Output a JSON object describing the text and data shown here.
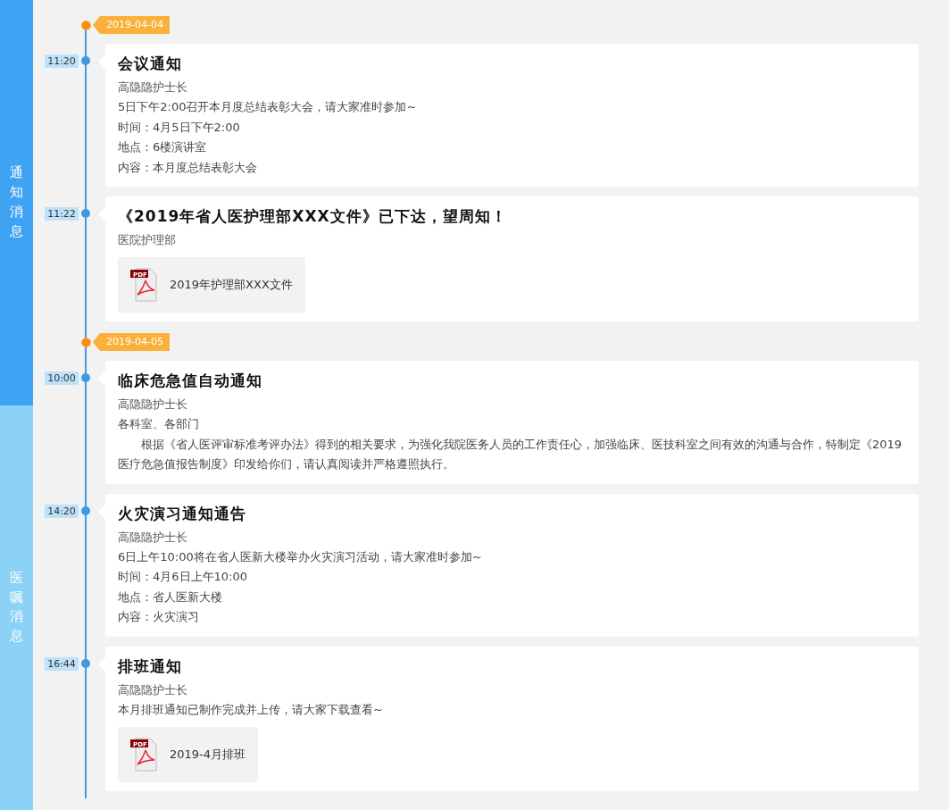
{
  "sidebar": {
    "tabs": [
      {
        "label": "通知消息",
        "selected": true
      },
      {
        "label": "医嘱消息",
        "selected": false
      }
    ]
  },
  "timeline": [
    {
      "date": "2019-04-04",
      "entries": [
        {
          "time": "11:20",
          "title": "会议通知",
          "author": "高隐隐护士长",
          "body": [
            {
              "kind": "line",
              "text": "5日下午2:00召开本月度总结表彰大会，请大家准时参加~"
            },
            {
              "kind": "line",
              "text": "时间：4月5日下午2:00"
            },
            {
              "kind": "line",
              "text": "地点：6楼演讲室"
            },
            {
              "kind": "line",
              "text": "内容：本月度总结表彰大会"
            }
          ]
        },
        {
          "time": "11:22",
          "title": "《2019年省人医护理部XXX文件》已下达，望周知！",
          "author": "医院护理部",
          "attachment": {
            "name": "2019年护理部XXX文件",
            "badge": "PDF"
          }
        }
      ]
    },
    {
      "date": "2019-04-05",
      "entries": [
        {
          "time": "10:00",
          "title": "临床危急值自动通知",
          "author": "高隐隐护士长",
          "body": [
            {
              "kind": "line",
              "text": "各科室、各部门"
            },
            {
              "kind": "paragraph",
              "text": "根据《省人医评审标准考评办法》得到的相关要求，为强化我院医务人员的工作责任心，加强临床、医技科室之间有效的沟通与合作，特制定《2019医疗危急值报告制度》印发给你们，请认真阅读并严格遵照执行。"
            }
          ]
        },
        {
          "time": "14:20",
          "title": "火灾演习通知通告",
          "author": "高隐隐护士长",
          "body": [
            {
              "kind": "line",
              "text": "6日上午10:00将在省人医新大楼举办火灾演习活动，请大家准时参加~"
            },
            {
              "kind": "line",
              "text": "时间：4月6日上午10:00"
            },
            {
              "kind": "line",
              "text": "地点：省人医新大楼"
            },
            {
              "kind": "line",
              "text": "内容：火灾演习"
            }
          ]
        },
        {
          "time": "16:44",
          "title": "排班通知",
          "author": "高隐隐护士长",
          "body": [
            {
              "kind": "line",
              "text": "本月排班通知已制作完成并上传，请大家下载查看~"
            }
          ],
          "attachment": {
            "name": "2019-4月排班",
            "badge": "PDF"
          }
        }
      ]
    }
  ]
}
